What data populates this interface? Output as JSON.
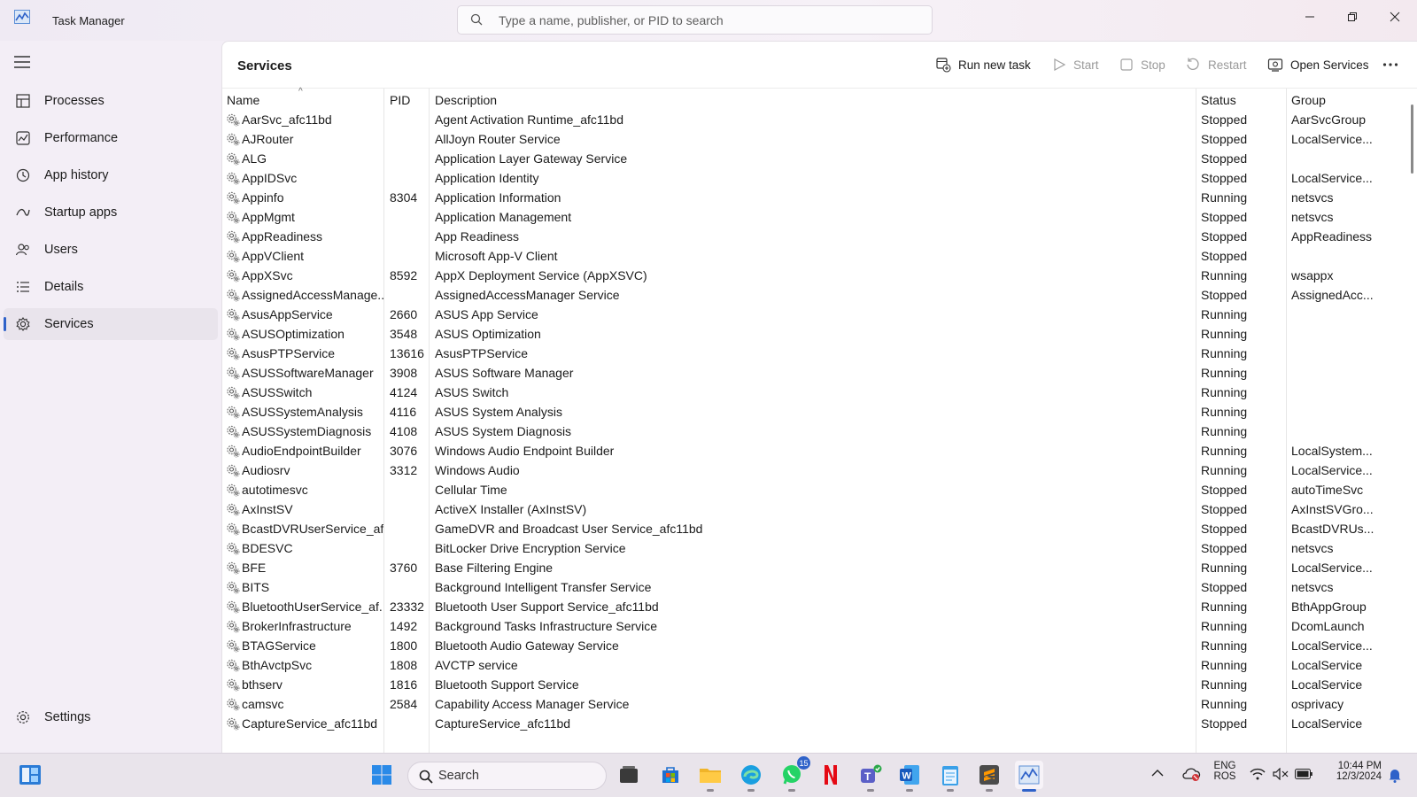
{
  "window": {
    "title": "Task Manager",
    "search_placeholder": "Type a name, publisher, or PID to search"
  },
  "sidebar": {
    "items": [
      {
        "label": "Processes",
        "icon": "processes-icon"
      },
      {
        "label": "Performance",
        "icon": "performance-icon"
      },
      {
        "label": "App history",
        "icon": "history-icon"
      },
      {
        "label": "Startup apps",
        "icon": "startup-icon"
      },
      {
        "label": "Users",
        "icon": "users-icon"
      },
      {
        "label": "Details",
        "icon": "details-icon"
      },
      {
        "label": "Services",
        "icon": "services-icon",
        "active": true
      }
    ],
    "settings_label": "Settings"
  },
  "toolbar": {
    "page_title": "Services",
    "run_new_task": "Run new task",
    "start": "Start",
    "stop": "Stop",
    "restart": "Restart",
    "open_services": "Open Services"
  },
  "table": {
    "columns": {
      "name": "Name",
      "pid": "PID",
      "description": "Description",
      "status": "Status",
      "group": "Group"
    },
    "rows": [
      {
        "name": "AarSvc_afc11bd",
        "pid": "",
        "description": "Agent Activation Runtime_afc11bd",
        "status": "Stopped",
        "group": "AarSvcGroup"
      },
      {
        "name": "AJRouter",
        "pid": "",
        "description": "AllJoyn Router Service",
        "status": "Stopped",
        "group": "LocalService..."
      },
      {
        "name": "ALG",
        "pid": "",
        "description": "Application Layer Gateway Service",
        "status": "Stopped",
        "group": ""
      },
      {
        "name": "AppIDSvc",
        "pid": "",
        "description": "Application Identity",
        "status": "Stopped",
        "group": "LocalService..."
      },
      {
        "name": "Appinfo",
        "pid": "8304",
        "description": "Application Information",
        "status": "Running",
        "group": "netsvcs"
      },
      {
        "name": "AppMgmt",
        "pid": "",
        "description": "Application Management",
        "status": "Stopped",
        "group": "netsvcs"
      },
      {
        "name": "AppReadiness",
        "pid": "",
        "description": "App Readiness",
        "status": "Stopped",
        "group": "AppReadiness"
      },
      {
        "name": "AppVClient",
        "pid": "",
        "description": "Microsoft App-V Client",
        "status": "Stopped",
        "group": ""
      },
      {
        "name": "AppXSvc",
        "pid": "8592",
        "description": "AppX Deployment Service (AppXSVC)",
        "status": "Running",
        "group": "wsappx"
      },
      {
        "name": "AssignedAccessManage...",
        "pid": "",
        "description": "AssignedAccessManager Service",
        "status": "Stopped",
        "group": "AssignedAcc..."
      },
      {
        "name": "AsusAppService",
        "pid": "2660",
        "description": "ASUS App Service",
        "status": "Running",
        "group": ""
      },
      {
        "name": "ASUSOptimization",
        "pid": "3548",
        "description": "ASUS Optimization",
        "status": "Running",
        "group": ""
      },
      {
        "name": "AsusPTPService",
        "pid": "13616",
        "description": "AsusPTPService",
        "status": "Running",
        "group": ""
      },
      {
        "name": "ASUSSoftwareManager",
        "pid": "3908",
        "description": "ASUS Software Manager",
        "status": "Running",
        "group": ""
      },
      {
        "name": "ASUSSwitch",
        "pid": "4124",
        "description": "ASUS Switch",
        "status": "Running",
        "group": ""
      },
      {
        "name": "ASUSSystemAnalysis",
        "pid": "4116",
        "description": "ASUS System Analysis",
        "status": "Running",
        "group": ""
      },
      {
        "name": "ASUSSystemDiagnosis",
        "pid": "4108",
        "description": "ASUS System Diagnosis",
        "status": "Running",
        "group": ""
      },
      {
        "name": "AudioEndpointBuilder",
        "pid": "3076",
        "description": "Windows Audio Endpoint Builder",
        "status": "Running",
        "group": "LocalSystem..."
      },
      {
        "name": "Audiosrv",
        "pid": "3312",
        "description": "Windows Audio",
        "status": "Running",
        "group": "LocalService..."
      },
      {
        "name": "autotimesvc",
        "pid": "",
        "description": "Cellular Time",
        "status": "Stopped",
        "group": "autoTimeSvc"
      },
      {
        "name": "AxInstSV",
        "pid": "",
        "description": "ActiveX Installer (AxInstSV)",
        "status": "Stopped",
        "group": "AxInstSVGro..."
      },
      {
        "name": "BcastDVRUserService_af...",
        "pid": "",
        "description": "GameDVR and Broadcast User Service_afc11bd",
        "status": "Stopped",
        "group": "BcastDVRUs..."
      },
      {
        "name": "BDESVC",
        "pid": "",
        "description": "BitLocker Drive Encryption Service",
        "status": "Stopped",
        "group": "netsvcs"
      },
      {
        "name": "BFE",
        "pid": "3760",
        "description": "Base Filtering Engine",
        "status": "Running",
        "group": "LocalService..."
      },
      {
        "name": "BITS",
        "pid": "",
        "description": "Background Intelligent Transfer Service",
        "status": "Stopped",
        "group": "netsvcs"
      },
      {
        "name": "BluetoothUserService_af...",
        "pid": "23332",
        "description": "Bluetooth User Support Service_afc11bd",
        "status": "Running",
        "group": "BthAppGroup"
      },
      {
        "name": "BrokerInfrastructure",
        "pid": "1492",
        "description": "Background Tasks Infrastructure Service",
        "status": "Running",
        "group": "DcomLaunch"
      },
      {
        "name": "BTAGService",
        "pid": "1800",
        "description": "Bluetooth Audio Gateway Service",
        "status": "Running",
        "group": "LocalService..."
      },
      {
        "name": "BthAvctpSvc",
        "pid": "1808",
        "description": "AVCTP service",
        "status": "Running",
        "group": "LocalService"
      },
      {
        "name": "bthserv",
        "pid": "1816",
        "description": "Bluetooth Support Service",
        "status": "Running",
        "group": "LocalService"
      },
      {
        "name": "camsvc",
        "pid": "2584",
        "description": "Capability Access Manager Service",
        "status": "Running",
        "group": "osprivacy"
      },
      {
        "name": "CaptureService_afc11bd",
        "pid": "",
        "description": "CaptureService_afc11bd",
        "status": "Stopped",
        "group": "LocalService"
      }
    ]
  },
  "taskbar": {
    "search_label": "Search",
    "whatsapp_badge": "15",
    "lang_line1": "ENG",
    "lang_line2": "ROS",
    "time": "10:44 PM",
    "date": "12/3/2024"
  },
  "colors": {
    "accent": "#2f62c9",
    "sidebar_bg": "#f3eef6",
    "content_bg": "#ffffff"
  }
}
